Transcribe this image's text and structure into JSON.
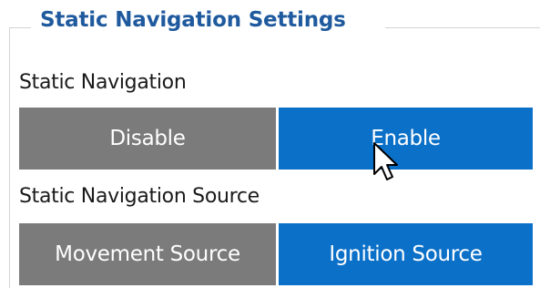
{
  "groupbox": {
    "title": "Static Navigation Settings"
  },
  "static_navigation": {
    "label": "Static Navigation",
    "options": [
      "Disable",
      "Enable"
    ],
    "selected": "Enable"
  },
  "static_navigation_source": {
    "label": "Static Navigation Source",
    "options": [
      "Movement Source",
      "Ignition Source"
    ],
    "selected": "Ignition Source"
  },
  "colors": {
    "selected_button": "#0b70c8",
    "unselected_button": "#7b7b7b",
    "group_title": "#1f5a9e"
  },
  "cursor": {
    "icon": "mouse-pointer-icon"
  }
}
